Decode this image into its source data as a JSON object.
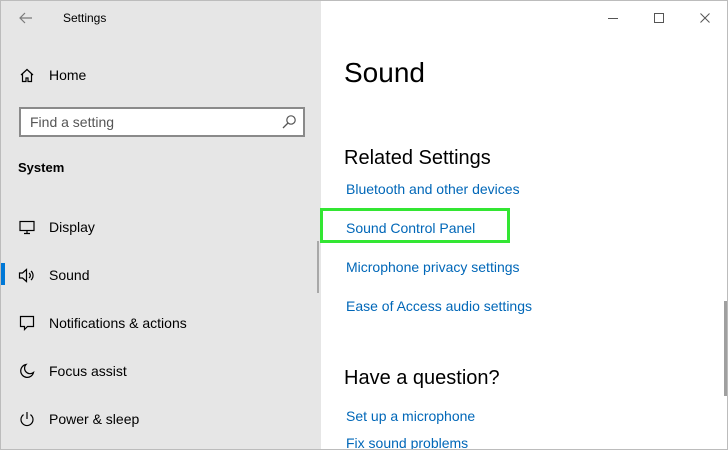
{
  "window": {
    "app_title": "Settings",
    "controls": {
      "minimize": "minimize-icon",
      "maximize": "maximize-icon",
      "close": "close-icon"
    }
  },
  "sidebar": {
    "home_label": "Home",
    "search_placeholder": "Find a setting",
    "section_title": "System",
    "items": [
      {
        "label": "Display",
        "icon": "monitor-icon",
        "active": false
      },
      {
        "label": "Sound",
        "icon": "speaker-icon",
        "active": true
      },
      {
        "label": "Notifications & actions",
        "icon": "notification-icon",
        "active": false
      },
      {
        "label": "Focus assist",
        "icon": "moon-icon",
        "active": false
      },
      {
        "label": "Power & sleep",
        "icon": "power-icon",
        "active": false
      }
    ]
  },
  "main": {
    "page_title": "Sound",
    "related_settings": {
      "heading": "Related Settings",
      "links": [
        "Bluetooth and other devices",
        "Sound Control Panel",
        "Microphone privacy settings",
        "Ease of Access audio settings"
      ]
    },
    "question": {
      "heading": "Have a question?",
      "links": [
        "Set up a microphone",
        "Fix sound problems"
      ]
    }
  },
  "colors": {
    "accent": "#0078d7",
    "link": "#0067b8",
    "highlight": "#33e633",
    "sidebar_bg": "#e6e6e6"
  }
}
